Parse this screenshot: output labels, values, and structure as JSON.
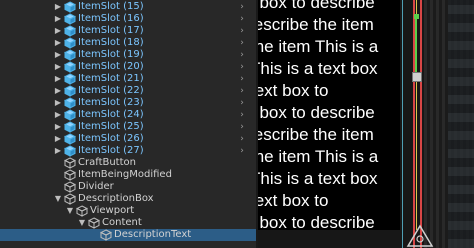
{
  "hierarchy": {
    "rows": [
      {
        "label": "ItemSlot (15)",
        "depth": 1,
        "foldout": "right",
        "icon": "prefab-cube-icon",
        "prefab": true
      },
      {
        "label": "ItemSlot (16)",
        "depth": 1,
        "foldout": "right",
        "icon": "prefab-cube-icon",
        "prefab": true
      },
      {
        "label": "ItemSlot (17)",
        "depth": 1,
        "foldout": "right",
        "icon": "prefab-cube-icon",
        "prefab": true
      },
      {
        "label": "ItemSlot (18)",
        "depth": 1,
        "foldout": "right",
        "icon": "prefab-cube-icon",
        "prefab": true
      },
      {
        "label": "ItemSlot (19)",
        "depth": 1,
        "foldout": "right",
        "icon": "prefab-cube-icon",
        "prefab": true
      },
      {
        "label": "ItemSlot (20)",
        "depth": 1,
        "foldout": "right",
        "icon": "prefab-cube-icon",
        "prefab": true
      },
      {
        "label": "ItemSlot (21)",
        "depth": 1,
        "foldout": "right",
        "icon": "prefab-cube-icon",
        "prefab": true
      },
      {
        "label": "ItemSlot (22)",
        "depth": 1,
        "foldout": "right",
        "icon": "prefab-cube-icon",
        "prefab": true
      },
      {
        "label": "ItemSlot (23)",
        "depth": 1,
        "foldout": "right",
        "icon": "prefab-cube-icon",
        "prefab": true
      },
      {
        "label": "ItemSlot (24)",
        "depth": 1,
        "foldout": "right",
        "icon": "prefab-cube-icon",
        "prefab": true
      },
      {
        "label": "ItemSlot (25)",
        "depth": 1,
        "foldout": "right",
        "icon": "prefab-cube-icon",
        "prefab": true
      },
      {
        "label": "ItemSlot (26)",
        "depth": 1,
        "foldout": "right",
        "icon": "prefab-cube-icon",
        "prefab": true
      },
      {
        "label": "ItemSlot (27)",
        "depth": 1,
        "foldout": "right",
        "icon": "prefab-cube-icon",
        "prefab": true
      },
      {
        "label": "CraftButton",
        "depth": 0,
        "foldout": "none",
        "icon": "gameobject-cube-icon",
        "prefab": false
      },
      {
        "label": "ItemBeingModified",
        "depth": 0,
        "foldout": "none",
        "icon": "gameobject-cube-icon",
        "prefab": false
      },
      {
        "label": "Divider",
        "depth": 0,
        "foldout": "none",
        "icon": "gameobject-cube-icon",
        "prefab": false
      },
      {
        "label": "DescriptionBox",
        "depth": 0,
        "foldout": "down",
        "icon": "gameobject-cube-icon",
        "prefab": false
      },
      {
        "label": "Viewport",
        "depth": 1,
        "foldout": "down",
        "icon": "gameobject-cube-icon",
        "prefab": false
      },
      {
        "label": "Content",
        "depth": 2,
        "foldout": "down",
        "icon": "gameobject-cube-icon",
        "prefab": false
      },
      {
        "label": "DescriptionText",
        "depth": 3,
        "foldout": "none",
        "icon": "gameobject-cube-icon",
        "prefab": false,
        "selected": true
      }
    ]
  },
  "scene": {
    "text_lines": [
      "t box to describe",
      "lescribe the item",
      "the item This is a",
      "This is a text box",
      "text box to",
      "t box to describe",
      "lescribe the item",
      "the item This is a",
      "This is a text box",
      "text box to",
      "t box to describe",
      "lescribe the item"
    ]
  },
  "colors": {
    "prefab_text": "#7cc6ff",
    "prefab_icon": "#4fb3e8",
    "normal_text": "#d2d2d2",
    "selection": "#2c5d87"
  }
}
